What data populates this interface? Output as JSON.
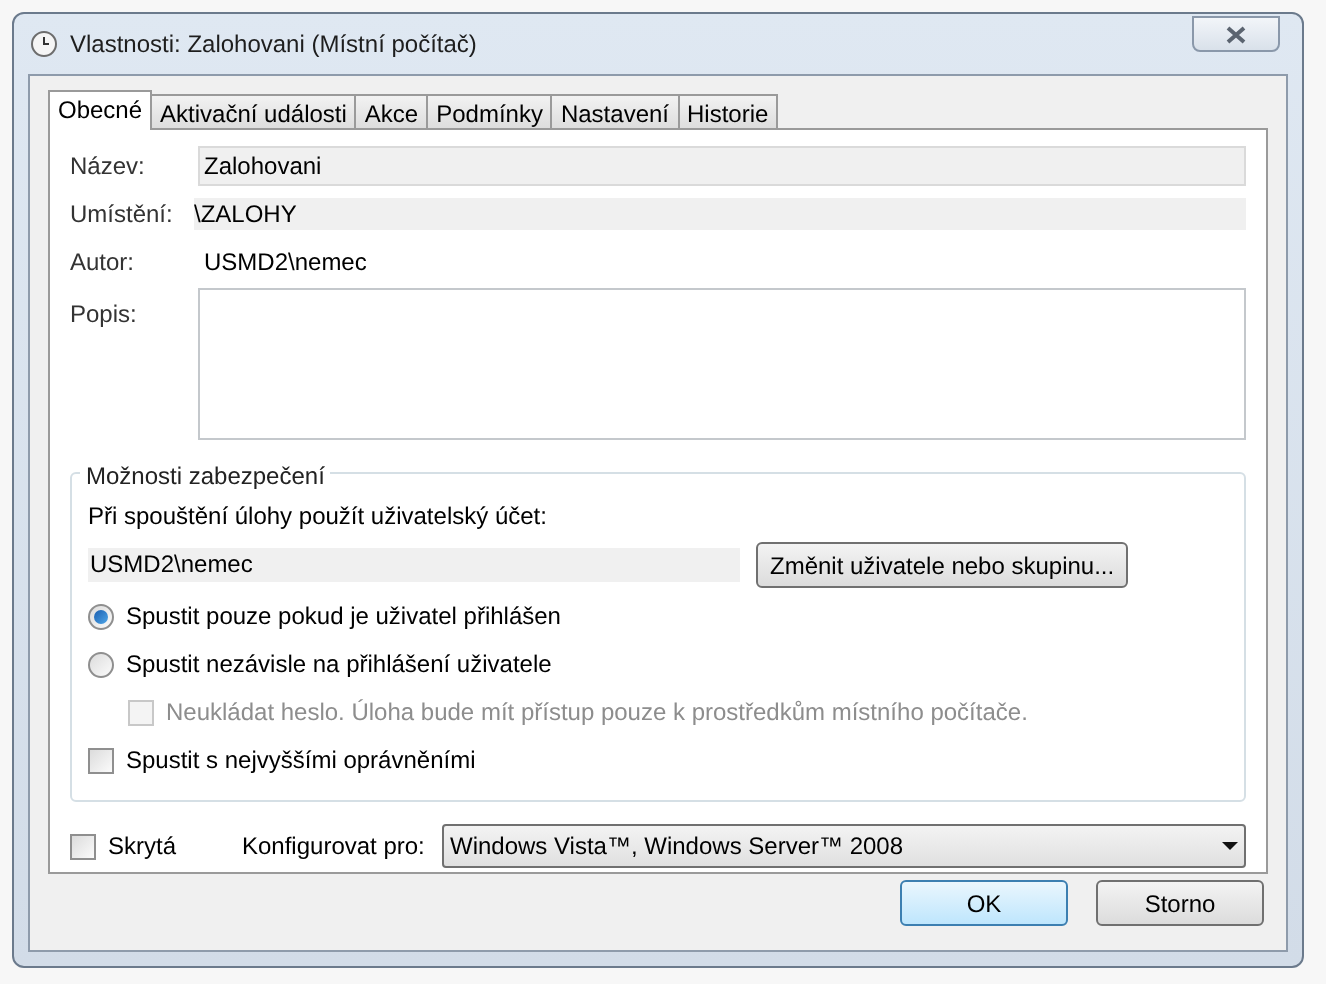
{
  "window": {
    "title": "Vlastnosti: Zalohovani (Místní počítač)"
  },
  "tabs": [
    {
      "label": "Obecné",
      "selected": true
    },
    {
      "label": "Aktivační události",
      "selected": false
    },
    {
      "label": "Akce",
      "selected": false
    },
    {
      "label": "Podmínky",
      "selected": false
    },
    {
      "label": "Nastavení",
      "selected": false
    },
    {
      "label": "Historie",
      "selected": false
    }
  ],
  "general": {
    "name": {
      "label": "Název:",
      "value": "Zalohovani"
    },
    "location": {
      "label": "Umístění:",
      "value": "\\ZALOHY"
    },
    "author": {
      "label": "Autor:",
      "value": "USMD2\\nemec"
    },
    "description": {
      "label": "Popis:"
    }
  },
  "security": {
    "title": "Možnosti zabezpečení",
    "account_label": "Při spouštění úlohy použít uživatelský účet:",
    "account_value": "USMD2\\nemec",
    "change_button": "Změnit uživatele nebo skupinu...",
    "options": [
      {
        "kind": "radio",
        "label": "Spustit pouze pokud je uživatel přihlášen",
        "selected": true
      },
      {
        "kind": "radio",
        "label": "Spustit nezávisle na přihlášení uživatele",
        "selected": false,
        "children": [
          {
            "kind": "checkbox",
            "label": "Neukládat heslo.  Úloha bude mít přístup pouze k prostředkům místního počítače.",
            "checked": false,
            "disabled": true
          }
        ]
      },
      {
        "kind": "checkbox",
        "label": "Spustit s nejvyššími oprávněními",
        "checked": false,
        "disabled": false
      }
    ]
  },
  "hidden": {
    "label": "Skrytá",
    "checked": false
  },
  "configure": {
    "label": "Konfigurovat pro:",
    "value": "Windows Vista™, Windows Server™ 2008"
  },
  "buttons": [
    {
      "label": "OK",
      "default": true
    },
    {
      "label": "Storno",
      "default": false
    }
  ]
}
